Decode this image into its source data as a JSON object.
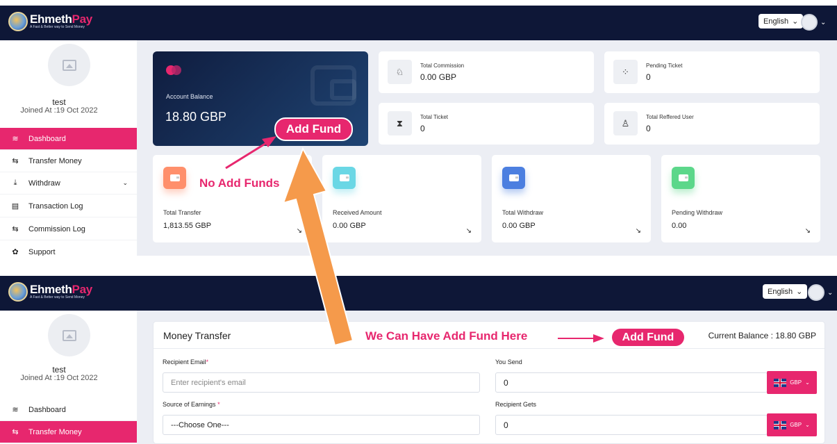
{
  "brand": {
    "name_a": "Ehmeth",
    "name_b": "Pay",
    "tagline": "A Fast & Better way to Send Money"
  },
  "language": "English",
  "profile": {
    "name": "test",
    "joined": "Joined At :19 Oct 2022"
  },
  "menu_top": [
    {
      "label": "Dashboard",
      "icon": "layers-icon",
      "active": true
    },
    {
      "label": "Transfer Money",
      "icon": "transfer-icon",
      "active": false
    },
    {
      "label": "Withdraw",
      "icon": "withdraw-icon",
      "active": false
    },
    {
      "label": "Transaction Log",
      "icon": "log-icon",
      "active": false
    },
    {
      "label": "Commission Log",
      "icon": "commission-icon",
      "active": false
    },
    {
      "label": "Support",
      "icon": "support-icon",
      "active": false
    }
  ],
  "menu_bottom": [
    {
      "label": "Dashboard",
      "icon": "layers-icon",
      "active": false
    },
    {
      "label": "Transfer Money",
      "icon": "transfer-icon",
      "active": true
    }
  ],
  "balance_card": {
    "label": "Account Balance",
    "value": "18.80 GBP"
  },
  "add_fund_label": "Add Fund",
  "stats": {
    "commission": {
      "label": "Total Commission",
      "value": "0.00 GBP"
    },
    "pending_ticket": {
      "label": "Pending Ticket",
      "value": "0"
    },
    "total_ticket": {
      "label": "Total Ticket",
      "value": "0"
    },
    "referred": {
      "label": "Total Reffered User",
      "value": "0"
    }
  },
  "summary": [
    {
      "label": "Total Transfer",
      "value": "1,813.55 GBP",
      "color": "#ff8f6b"
    },
    {
      "label": "Received Amount",
      "value": "0.00 GBP",
      "color": "#6ad7e5"
    },
    {
      "label": "Total Withdraw",
      "value": "0.00 GBP",
      "color": "#4c7fe0"
    },
    {
      "label": "Pending Withdraw",
      "value": "0.00",
      "color": "#5cd78a"
    }
  ],
  "annotations": {
    "no_add_funds": "No Add Funds",
    "we_can_have": "We Can Have Add Fund Here"
  },
  "transfer": {
    "title": "Money Transfer",
    "current_balance": "Current Balance : 18.80 GBP",
    "recipient_email_label": "Recipient Email",
    "recipient_email_placeholder": "Enter recipient's email",
    "source_label": "Source of Earnings",
    "source_value": "---Choose One---",
    "you_send_label": "You Send",
    "you_send_value": "0",
    "recipient_gets_label": "Recipient Gets",
    "recipient_gets_value": "0",
    "currency": "GBP"
  },
  "colors": {
    "accent": "#e7276e",
    "navy": "#0e1737",
    "annotation_arrow": "#f59a4b"
  }
}
